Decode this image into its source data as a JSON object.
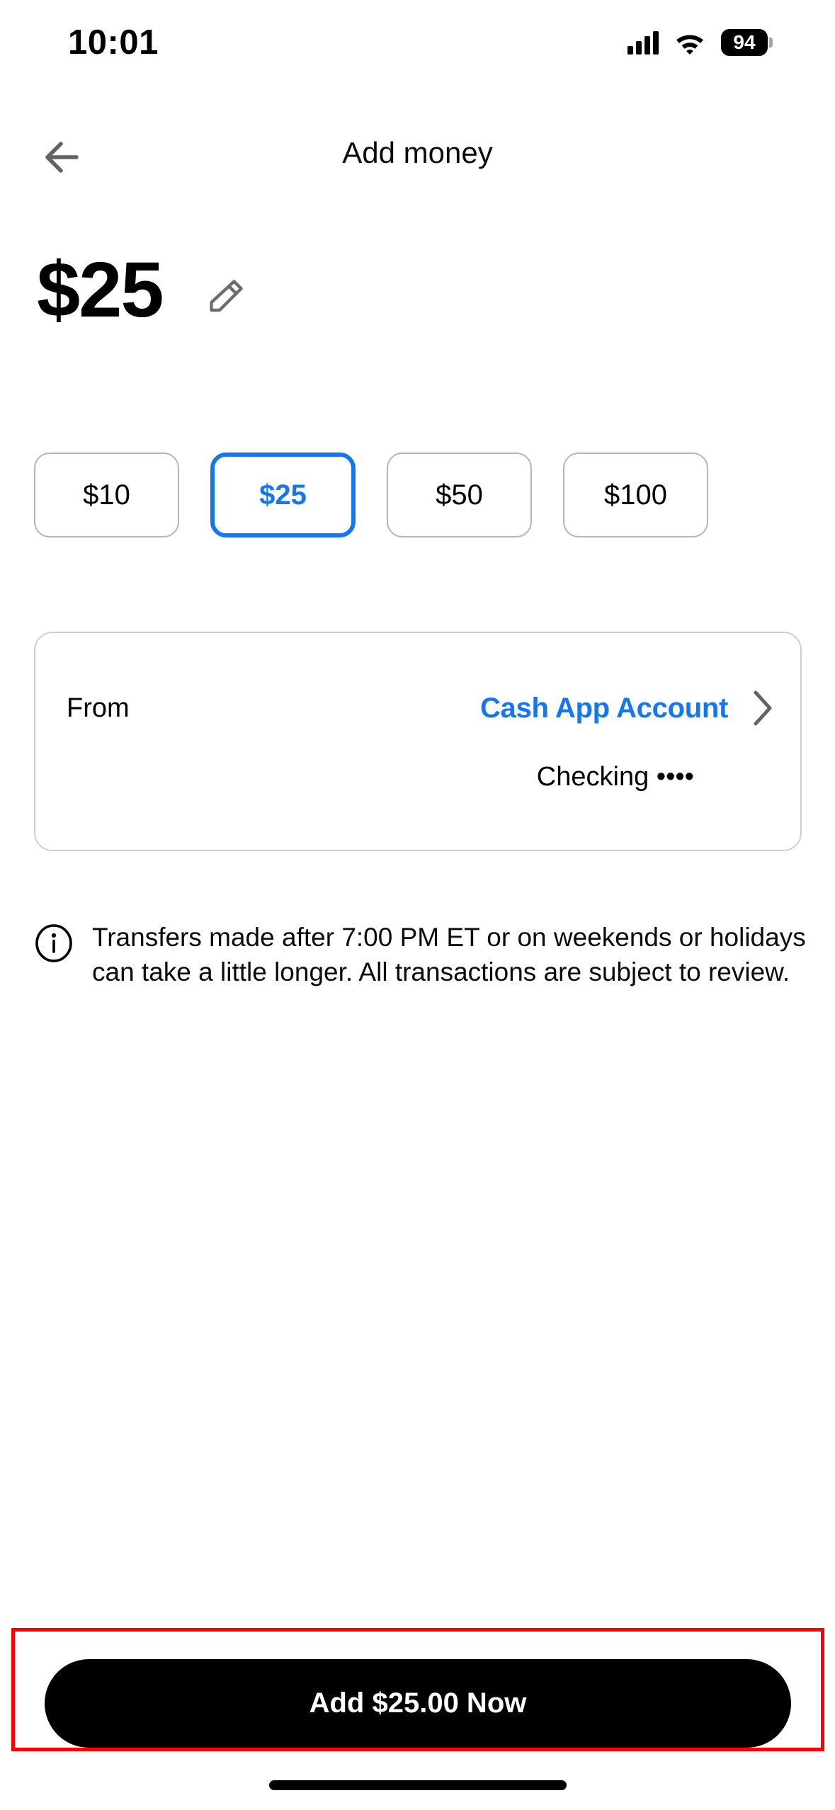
{
  "status_bar": {
    "time": "10:01",
    "cellular_icon": "signal-bars-icon",
    "wifi_icon": "wifi-icon",
    "battery_level": "94"
  },
  "header": {
    "back_icon": "arrow-left-icon",
    "title": "Add money"
  },
  "amount": {
    "display": "$25",
    "edit_icon": "pencil-icon"
  },
  "presets": {
    "options": [
      {
        "label": "$10",
        "selected": false
      },
      {
        "label": "$25",
        "selected": true
      },
      {
        "label": "$50",
        "selected": false
      },
      {
        "label": "$100",
        "selected": false
      }
    ]
  },
  "source": {
    "label": "From",
    "value": "Cash App Account",
    "sub_value": "Checking ••••",
    "chevron_icon": "chevron-right-icon"
  },
  "disclaimer": {
    "icon": "info-circle-icon",
    "text": "Transfers made after 7:00 PM ET or on weekends or holidays can take a little longer. All transactions are subject to review."
  },
  "cta": {
    "label": "Add $25.00 Now",
    "highlighted": true
  },
  "colors": {
    "accent_blue": "#1577f0",
    "button_black": "#000000",
    "highlight_red": "#ff0000",
    "border_gray": "#b5b5b5"
  }
}
